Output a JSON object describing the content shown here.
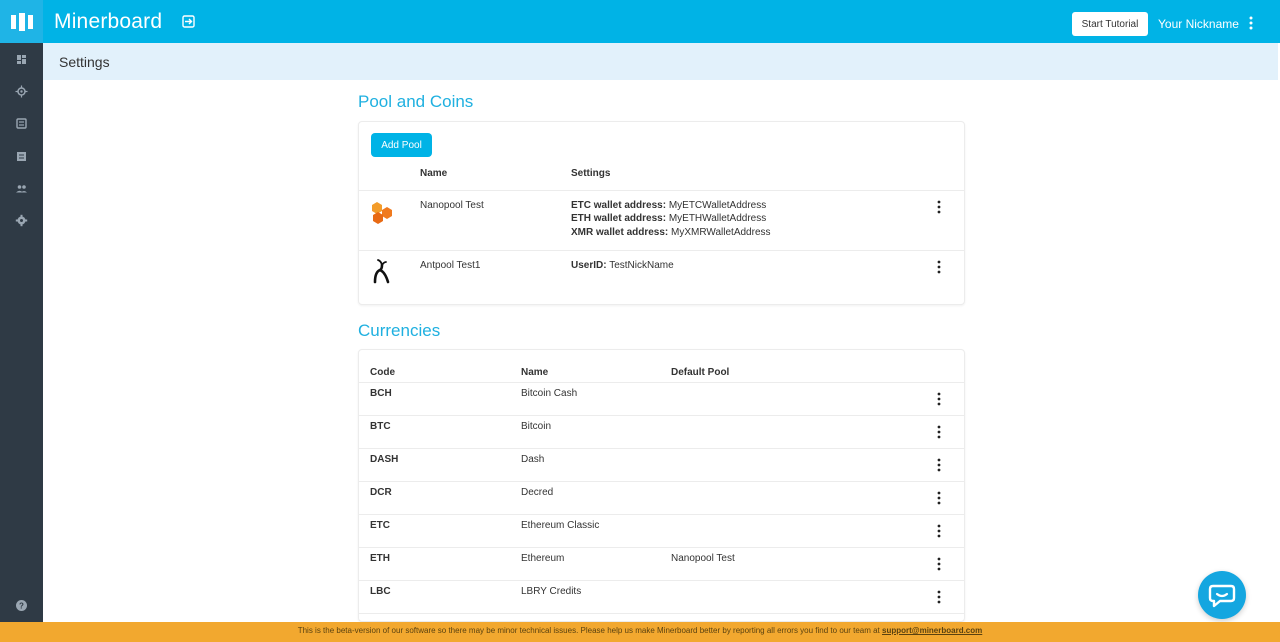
{
  "app": {
    "title": "Minerboard"
  },
  "header": {
    "tutorial_label": "Start Tutorial",
    "nickname": "Your Nickname"
  },
  "breadcrumb": {
    "title": "Settings"
  },
  "sidebar": {
    "items": [
      {
        "icon": "dashboard-icon"
      },
      {
        "icon": "mining-icon"
      },
      {
        "icon": "reports-icon"
      },
      {
        "icon": "list-icon"
      },
      {
        "icon": "users-icon"
      },
      {
        "icon": "gear-icon"
      }
    ],
    "help_icon": "help-icon"
  },
  "pools": {
    "title": "Pool and Coins",
    "add_label": "Add Pool",
    "headers": {
      "name": "Name",
      "settings": "Settings"
    },
    "rows": [
      {
        "name": "Nanopool Test",
        "icon": "nanopool-icon",
        "settings": [
          {
            "label": "ETC wallet address:",
            "value": "MyETCWalletAddress"
          },
          {
            "label": "ETH wallet address:",
            "value": "MyETHWalletAddress"
          },
          {
            "label": "XMR wallet address:",
            "value": "MyXMRWalletAddress"
          }
        ]
      },
      {
        "name": "Antpool Test1",
        "icon": "antpool-icon",
        "settings": [
          {
            "label": "UserID:",
            "value": "TestNickName"
          }
        ]
      }
    ]
  },
  "currencies": {
    "title": "Currencies",
    "headers": {
      "code": "Code",
      "name": "Name",
      "default_pool": "Default Pool"
    },
    "rows": [
      {
        "code": "BCH",
        "name": "Bitcoin Cash",
        "pool": ""
      },
      {
        "code": "BTC",
        "name": "Bitcoin",
        "pool": ""
      },
      {
        "code": "DASH",
        "name": "Dash",
        "pool": ""
      },
      {
        "code": "DCR",
        "name": "Decred",
        "pool": ""
      },
      {
        "code": "ETC",
        "name": "Ethereum Classic",
        "pool": ""
      },
      {
        "code": "ETH",
        "name": "Ethereum",
        "pool": "Nanopool Test"
      },
      {
        "code": "LBC",
        "name": "LBRY Credits",
        "pool": ""
      }
    ]
  },
  "banner": {
    "text": "This is the beta-version of our software so there may be minor technical issues. Please help us make Minerboard better by reporting all errors you find to our team at ",
    "email": "support@minerboard.com"
  },
  "colors": {
    "accent": "#00b3e6",
    "sidebar": "#2f3a45",
    "breadcrumb_bg": "#e2f1fb",
    "banner": "#f2a82f",
    "title": "#1fb0e0"
  }
}
